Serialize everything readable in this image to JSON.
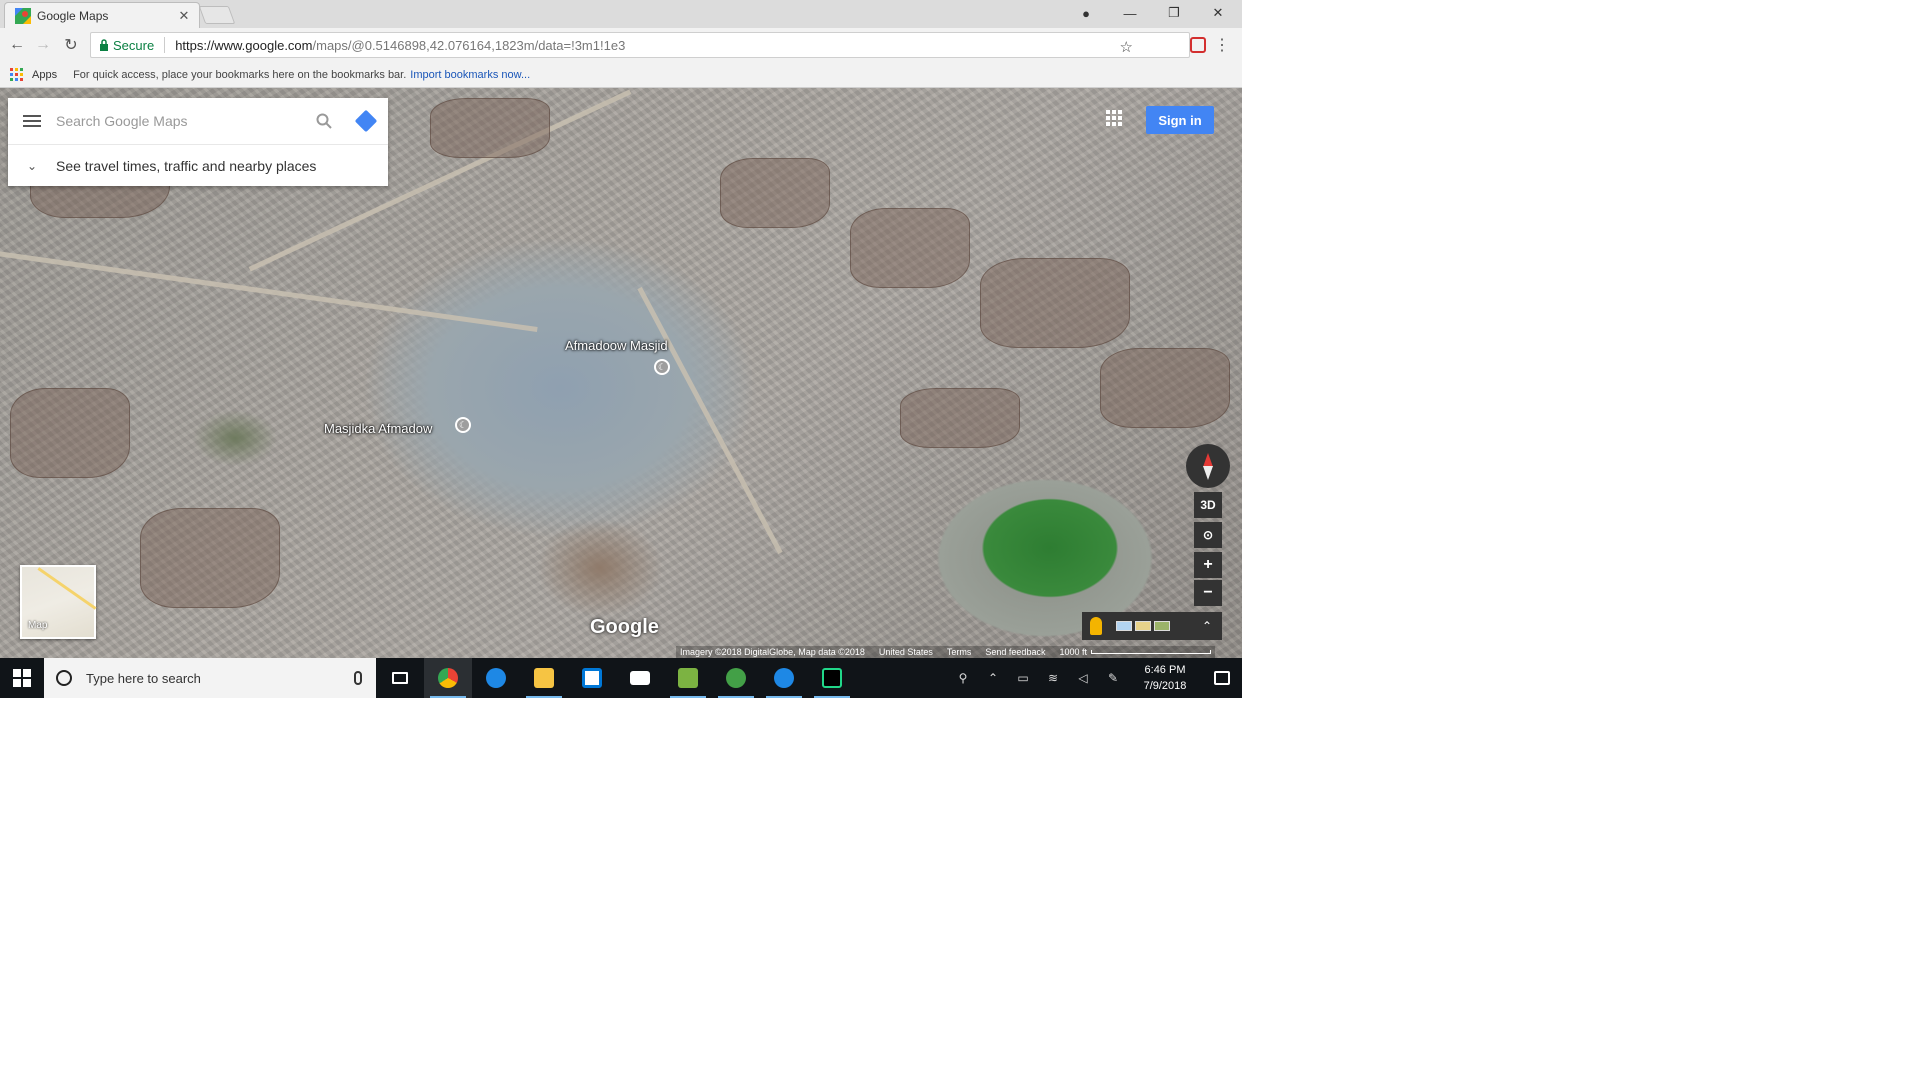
{
  "browser": {
    "tab_title": "Google Maps",
    "secure_label": "Secure",
    "url_host": "https://www.google.com",
    "url_rest": "/maps/@0.5146898,42.076164,1823m/data=!3m1!1e3",
    "bookmarks": {
      "apps_label": "Apps",
      "hint": "For quick access, place your bookmarks here on the bookmarks bar.",
      "import_link": "Import bookmarks now..."
    }
  },
  "maps": {
    "search_placeholder": "Search Google Maps",
    "travel_text": "See travel times, traffic and nearby places",
    "signin_label": "Sign in",
    "labels": {
      "place1": "Afmadoow Masjid",
      "place2": "Masjidka Afmadow"
    },
    "controls": {
      "three_d": "3D",
      "zoom_in": "+",
      "zoom_out": "−"
    },
    "minimap_label": "Map",
    "logo": "Google",
    "attribution": {
      "imagery": "Imagery ©2018 DigitalGlobe, Map data ©2018",
      "country": "United States",
      "terms": "Terms",
      "feedback": "Send feedback",
      "scale": "1000 ft"
    }
  },
  "taskbar": {
    "search_text": "Type here to search",
    "time": "6:46 PM",
    "date": "7/9/2018"
  },
  "icons": [
    "maps-favicon",
    "back-icon",
    "forward-icon",
    "reload-icon",
    "lock-icon",
    "star-icon",
    "extension-icon",
    "menu-icon",
    "apps-icon",
    "hamburger-icon",
    "search-icon",
    "directions-icon",
    "chevron-down-icon",
    "grid-icon",
    "compass-icon",
    "pegman-icon",
    "windows-icon",
    "cortana-icon",
    "mic-icon"
  ],
  "colors": {
    "accent": "#4285f4",
    "secure": "#0b8043",
    "taskbar": "#101418"
  }
}
